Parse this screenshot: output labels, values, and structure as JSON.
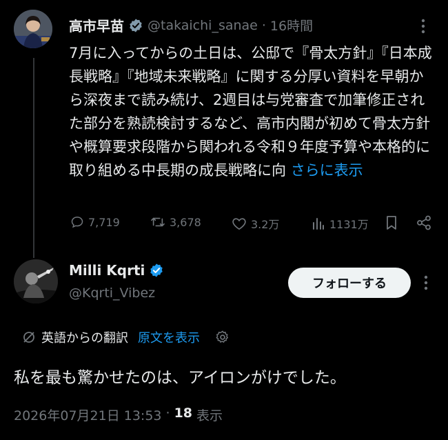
{
  "original_tweet": {
    "author_name": "高市早苗",
    "handle": "@takaichi_sanae",
    "separator": "·",
    "time_ago": "16時間",
    "text": "7月に入ってからの土日は、公邸で『骨太方針』『日本成長戦略』『地域未来戦略』に関する分厚い資料を早朝から深夜まで読み続け、2週目は与党審査で加筆修正された部分を熟読検討するなど、高市内閣が初めて骨太方針や概算要求段階から関われる令和９年度予算や本格的に取り組める中長期の成長戦略に向",
    "show_more": "さらに表示",
    "stats": {
      "replies": "7,719",
      "retweets": "3,678",
      "likes": "3.2万",
      "views": "1131万"
    }
  },
  "reply": {
    "author_name": "Milli Kqrti",
    "handle": "@Kqrti_Vibez",
    "follow_label": "フォローする",
    "translated_label": "英語からの翻訳",
    "show_original": "原文を表示",
    "text": "私を最も驚かせたのは、アイロンがけでした。",
    "timestamp": "2026年07月21日 13:53",
    "dot": "·",
    "view_count": "18",
    "view_label": "表示"
  },
  "colors": {
    "background": "#000000",
    "text": "#e7e9ea",
    "muted": "#71767b",
    "link": "#1d9bf0",
    "verified_blue": "#1d9bf0",
    "verified_gray": "#829aab"
  }
}
